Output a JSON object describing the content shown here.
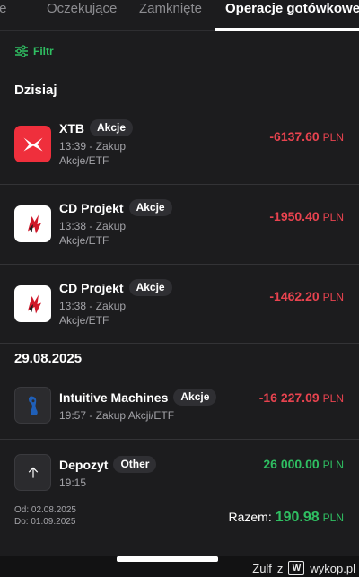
{
  "tabs": [
    {
      "label": "rte"
    },
    {
      "label": "Oczekujące"
    },
    {
      "label": "Zamknięte"
    },
    {
      "label": "Operacje gotówkowe"
    }
  ],
  "filter_label": "Filtr",
  "sections": [
    {
      "title": "Dzisiaj"
    },
    {
      "title": "29.08.2025"
    }
  ],
  "operations": [
    {
      "name": "XTB",
      "badge": "Akcje",
      "time": "13:39 - Zakup",
      "detail": "Akcje/ETF",
      "amount": "-6137.60",
      "currency": "PLN",
      "logo": "xtb-logo"
    },
    {
      "name": "CD Projekt",
      "badge": "Akcje",
      "time": "13:38 - Zakup",
      "detail": "Akcje/ETF",
      "amount": "-1950.40",
      "currency": "PLN",
      "logo": "cd-projekt-logo"
    },
    {
      "name": "CD Projekt",
      "badge": "Akcje",
      "time": "13:38 - Zakup",
      "detail": "Akcje/ETF",
      "amount": "-1462.20",
      "currency": "PLN",
      "logo": "cd-projekt-logo"
    },
    {
      "name": "Intuitive Machines",
      "badge": "Akcje",
      "time": "19:57 - Zakup Akcji/ETF",
      "amount": "-16 227.09",
      "currency": "PLN",
      "logo": "intuitive-machines-logo"
    },
    {
      "name": "Depozyt",
      "badge": "Other",
      "time": "19:15",
      "amount": "26 000.00",
      "currency": "PLN",
      "logo": "arrow-up-icon"
    }
  ],
  "summary": {
    "from_label": "Od: 02.08.2025",
    "to_label": "Do: 01.09.2025",
    "total_label": "Razem:",
    "total_value": "190.98",
    "total_currency": "PLN"
  },
  "watermark": {
    "user": "Zulf",
    "sep": "z",
    "site": "wykop.pl",
    "mark": "W"
  },
  "colors": {
    "negative": "#e8434f",
    "positive": "#2fbf62",
    "background": "#1c1c1e",
    "xtb_brand": "#ef2f3c"
  }
}
